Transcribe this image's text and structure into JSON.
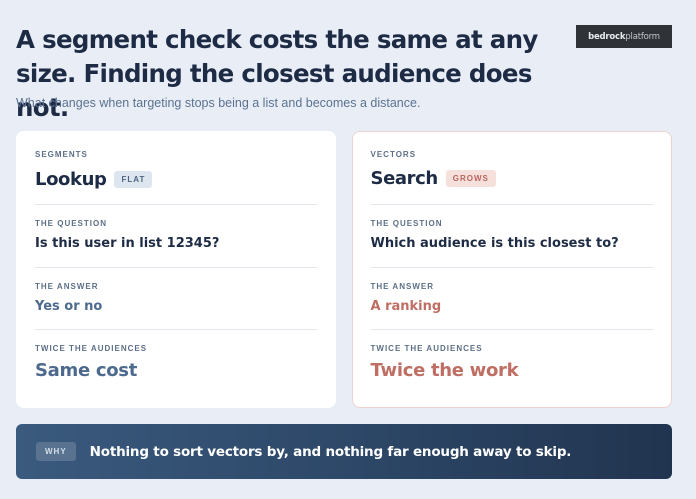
{
  "header": {
    "title": "A segment check costs the same at any size. Finding the closest audience does not.",
    "subtitle": "What changes when targeting stops being a list and becomes a distance.",
    "logo_bold": "bedrock",
    "logo_light": "platform"
  },
  "cards": {
    "left": {
      "eyebrow": "SEGMENTS",
      "heading": "Lookup",
      "badge": "FLAT",
      "question_label": "THE QUESTION",
      "question": "Is this user in list 12345?",
      "answer_label": "THE ANSWER",
      "answer": "Yes or no",
      "twice_label": "TWICE THE AUDIENCES",
      "twice": "Same cost"
    },
    "right": {
      "eyebrow": "VECTORS",
      "heading": "Search",
      "badge": "GROWS",
      "question_label": "THE QUESTION",
      "question": "Which audience is this closest to?",
      "answer_label": "THE ANSWER",
      "answer": "A ranking",
      "twice_label": "TWICE THE AUDIENCES",
      "twice": "Twice the work"
    }
  },
  "why": {
    "tag": "WHY",
    "text": "Nothing to sort vectors by, and nothing far enough away to skip."
  }
}
